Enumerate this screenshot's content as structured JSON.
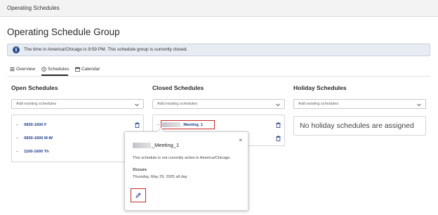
{
  "topbar": {
    "title": "Operating Schedules"
  },
  "page": {
    "title": "Operating Schedule Group"
  },
  "banner": {
    "icon": "info-icon",
    "text": "The time in America/Chicago is 9:59 PM. This schedule group is currently closed."
  },
  "tabs": [
    {
      "label": "Overview",
      "icon": "list-icon"
    },
    {
      "label": "Schedules",
      "icon": "clock-icon",
      "active": true
    },
    {
      "label": "Calendar",
      "icon": "calendar-icon"
    }
  ],
  "columns": {
    "open": {
      "title": "Open Schedules",
      "placeholder": "Add existing schedules",
      "items": [
        "0830-1600 F",
        "0830-1600 M-W",
        "1100-1600 Th"
      ]
    },
    "closed": {
      "title": "Closed Schedules",
      "placeholder": "Add existing schedules",
      "items": [
        "_Meeting_1"
      ]
    },
    "holiday": {
      "title": "Holiday Schedules",
      "placeholder": "Add existing schedules",
      "empty_message": "No holiday schedules are assigned"
    }
  },
  "popover": {
    "title": "_Meeting_1",
    "description": "This schedule is not currently active in America/Chicago.",
    "occurs_label": "Occurs",
    "occurs_value": "Thursday, May 29, 2025 all day",
    "close_glyph": "×"
  },
  "colors": {
    "link": "#1b3a8a",
    "highlight": "#c62828",
    "info": "#2f4d8c"
  }
}
